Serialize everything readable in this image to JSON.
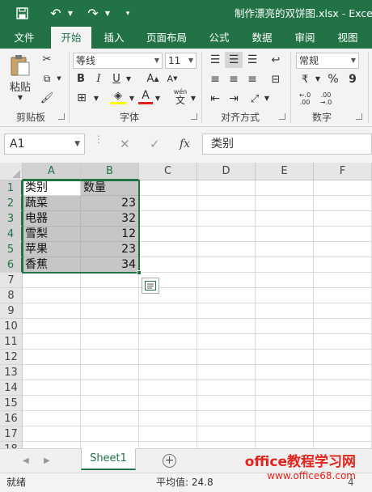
{
  "window": {
    "title": "制作漂亮的双饼图.xlsx - Exce"
  },
  "tabs": [
    {
      "label": "文件"
    },
    {
      "label": "开始"
    },
    {
      "label": "插入"
    },
    {
      "label": "页面布局"
    },
    {
      "label": "公式"
    },
    {
      "label": "数据"
    },
    {
      "label": "审阅"
    },
    {
      "label": "视图"
    }
  ],
  "active_tab": "开始",
  "ribbon": {
    "clipboard": {
      "paste_label": "粘贴",
      "group_label": "剪贴板"
    },
    "font": {
      "font_name": "等线",
      "font_size": "11",
      "group_label": "字体",
      "wen_label": "wén",
      "wen_char": "文"
    },
    "alignment": {
      "group_label": "对齐方式"
    },
    "number": {
      "format": "常规",
      "group_label": "数字",
      "percent": "%",
      "comma": "9",
      "inc_decimal": "←.0 .00",
      "dec_decimal": ".00 →.0"
    }
  },
  "formula_bar": {
    "name_box": "A1",
    "fx": "fx",
    "content": "类别"
  },
  "sheet": {
    "columns": [
      "A",
      "B",
      "C",
      "D",
      "E",
      "F"
    ],
    "rows": [
      "1",
      "2",
      "3",
      "4",
      "5",
      "6",
      "7",
      "8",
      "9",
      "10",
      "11",
      "12",
      "13",
      "14",
      "15",
      "16",
      "17",
      "18"
    ],
    "cells": [
      [
        "类别",
        "数量"
      ],
      [
        "蔬菜",
        "23"
      ],
      [
        "电器",
        "32"
      ],
      [
        "雪梨",
        "12"
      ],
      [
        "苹果",
        "23"
      ],
      [
        "香蕉",
        "34"
      ]
    ]
  },
  "sheet_tabs": [
    {
      "label": "Sheet1"
    }
  ],
  "status": {
    "ready": "就绪",
    "average": "平均值: 24.8",
    "tail": "4"
  },
  "watermark": {
    "name": "office教程学习网",
    "url": "www.office68.com"
  },
  "colors": {
    "accent": "#217346",
    "watermark": "#e3241b",
    "font_color_bar": "#e02020",
    "fill_color_bar": "#ffff00"
  }
}
